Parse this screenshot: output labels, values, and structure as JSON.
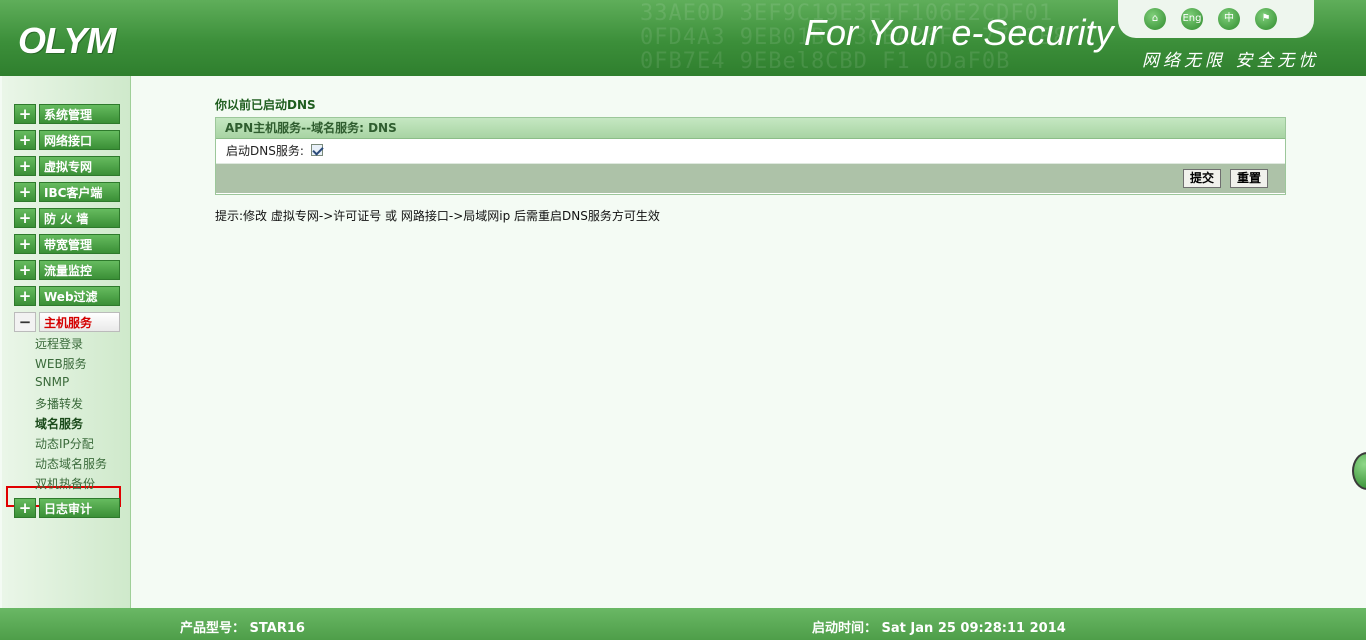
{
  "header": {
    "logo": "OLYM",
    "slogan": "For Your e-Security",
    "slogan_cn": "网络无限 安全无忧",
    "icons": [
      "home-icon",
      "english-icon",
      "chinese-icon",
      "flag-icon"
    ],
    "icon_texts": [
      "⌂",
      "Eng",
      "中",
      "⚑"
    ]
  },
  "sidebar": {
    "menu": [
      {
        "label": "系统管理",
        "expanded": false
      },
      {
        "label": "网络接口",
        "expanded": false
      },
      {
        "label": "虚拟专网",
        "expanded": false
      },
      {
        "label": "IBC客户端",
        "expanded": false
      },
      {
        "label": "防 火 墙",
        "expanded": false
      },
      {
        "label": "带宽管理",
        "expanded": false
      },
      {
        "label": "流量监控",
        "expanded": false
      },
      {
        "label": "Web过滤",
        "expanded": false
      },
      {
        "label": "主机服务",
        "expanded": true
      },
      {
        "label": "日志审计",
        "expanded": false
      }
    ],
    "expand_symbol": "+",
    "collapse_symbol": "−",
    "sub_items": [
      "远程登录",
      "WEB服务",
      "SNMP",
      "多播转发",
      "域名服务",
      "动态IP分配",
      "动态域名服务",
      "双机热备份"
    ],
    "active_sub": "域名服务"
  },
  "main": {
    "title": "你以前已启动DNS",
    "panel_header": "APN主机服务--域名服务: DNS",
    "enable_label": "启动DNS服务:",
    "enable_checked": true,
    "submit_label": "提交",
    "reset_label": "重置",
    "hint": "提示:修改 虚拟专网->许可证号 或 网路接口->局域网ip 后需重启DNS服务方可生效"
  },
  "footer": {
    "model_label": "产品型号：",
    "model_value": "STAR16",
    "boot_label": "启动时间：",
    "boot_value": "Sat Jan 25 09:28:11 2014"
  },
  "colors": {
    "header_green": "#3c8f3a",
    "menu_green": "#4ea549",
    "active_red": "#d40000",
    "footer_green": "#5aa955"
  }
}
